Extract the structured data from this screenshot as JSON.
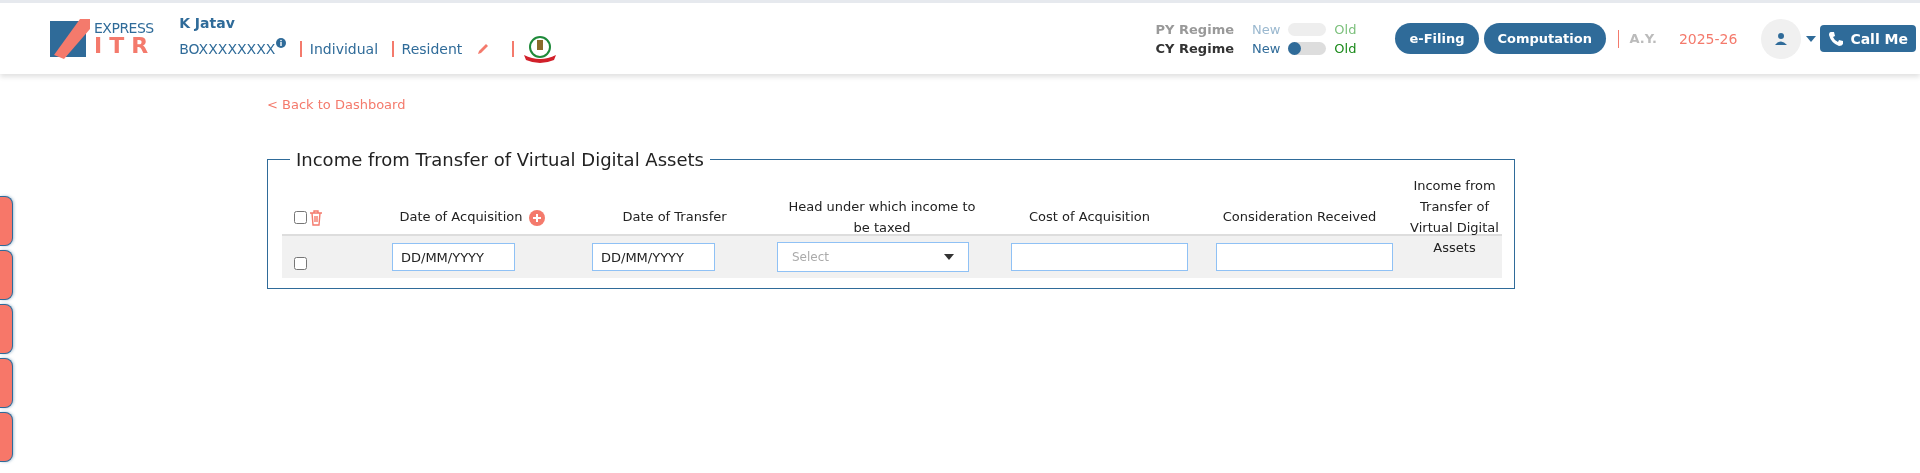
{
  "header": {
    "logo": {
      "top": "EXPRESS",
      "bottom": "ITR"
    },
    "user_name": "K Jatav",
    "pan": "BOXXXXXXXX",
    "category": "Individual",
    "residency": "Resident"
  },
  "regimes": [
    {
      "label": "PY Regime",
      "new": "New",
      "old": "Old",
      "disabled": true
    },
    {
      "label": "CY Regime",
      "new": "New",
      "old": "Old",
      "disabled": false,
      "new_selected": true
    }
  ],
  "nav_buttons": [
    "e-Filing",
    "Computation"
  ],
  "assessment_year": {
    "label": "A.Y.",
    "value": "2025-26"
  },
  "call_button": "Call Me",
  "back_link": "< Back to Dashboard",
  "section": {
    "title": "Income from Transfer of Virtual Digital Assets",
    "select_all": {
      "checked": false
    },
    "columns": [
      {
        "label": "Date of Acquisition",
        "kind": "add"
      },
      {
        "label": "Date of Transfer",
        "kind": "plain"
      },
      {
        "label": "Head under which income to be taxed",
        "kind": "plain"
      },
      {
        "label": "Cost of Acquisition",
        "kind": "plain"
      },
      {
        "label": "Consideration Received",
        "kind": "plain"
      },
      {
        "label": "Income from Transfer of Virtual Digital Assets",
        "kind": "plain"
      }
    ],
    "rows": [
      {
        "checked": false,
        "date_of_acquisition": {
          "placeholder": "DD/MM/YYYY"
        },
        "date_of_transfer": {
          "placeholder": "DD/MM/YYYY"
        },
        "head": {
          "placeholder": "Select"
        }
      }
    ]
  }
}
